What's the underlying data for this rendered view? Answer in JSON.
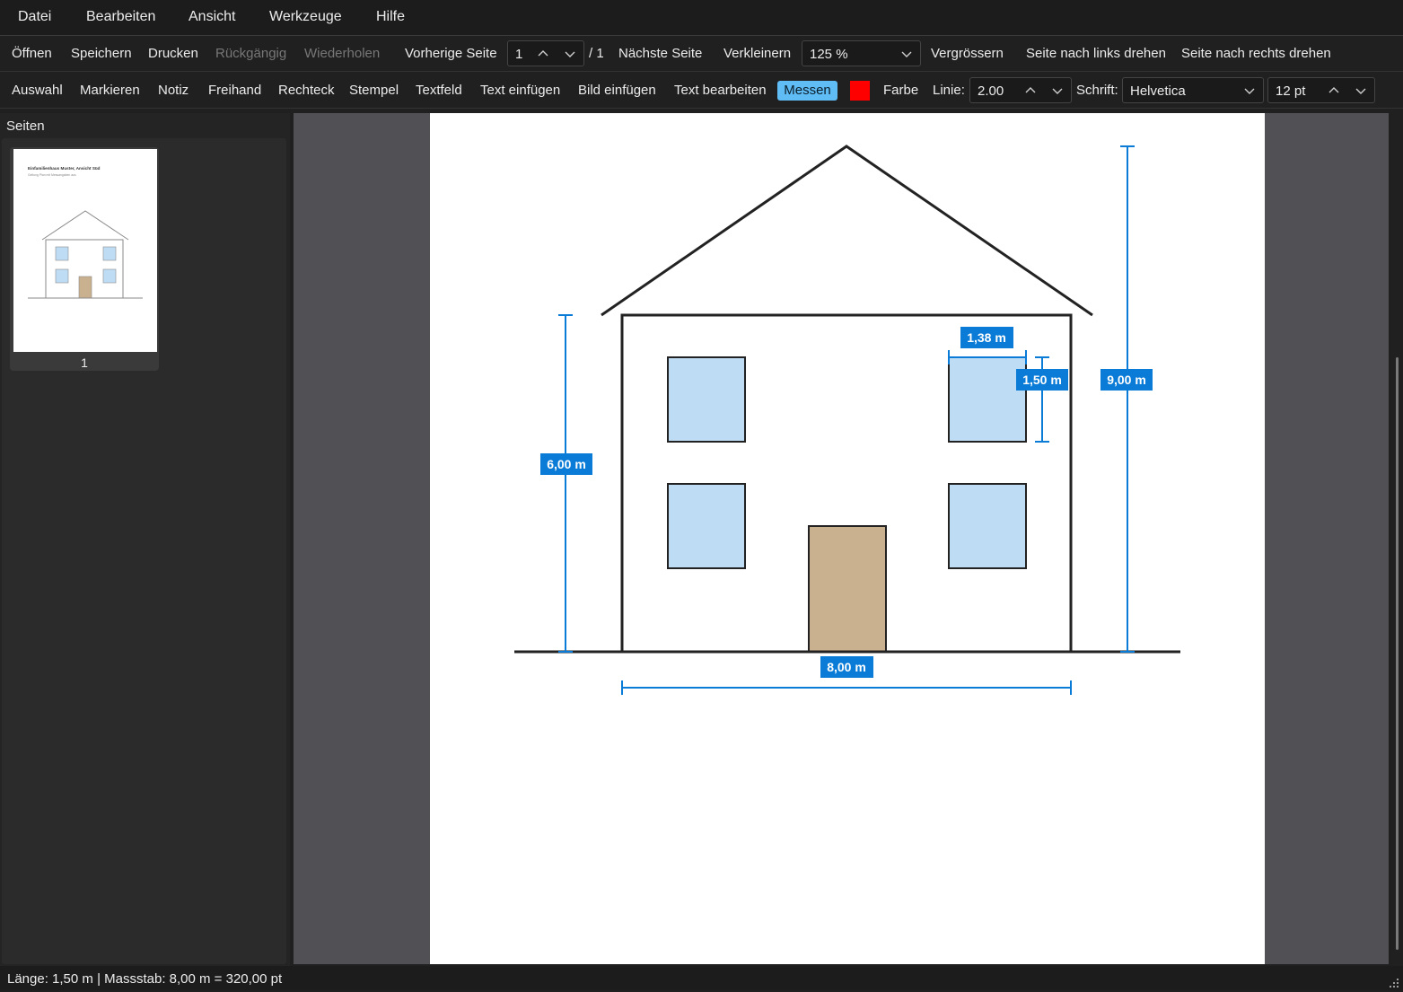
{
  "menu": [
    "Datei",
    "Bearbeiten",
    "Ansicht",
    "Werkzeuge",
    "Hilfe"
  ],
  "toolbar1": {
    "open": "Öffnen",
    "save": "Speichern",
    "print": "Drucken",
    "undo": "Rückgängig",
    "redo": "Wiederholen",
    "prev_page": "Vorherige Seite",
    "page_value": "1",
    "page_total": "/ 1",
    "next_page": "Nächste Seite",
    "zoom_out": "Verkleinern",
    "zoom_value": "125 %",
    "zoom_in": "Vergrössern",
    "rotate_left": "Seite nach links drehen",
    "rotate_right": "Seite nach rechts drehen"
  },
  "toolbar2": {
    "tools": [
      "Auswahl",
      "Markieren",
      "Notiz",
      "Freihand",
      "Rechteck",
      "Stempel",
      "Textfeld",
      "Text einfügen",
      "Bild einfügen",
      "Text bearbeiten"
    ],
    "active_tool": "Messen",
    "color_label": "Farbe",
    "color_value": "#ff0000",
    "line_label": "Linie:",
    "line_value": "2.00",
    "font_label": "Schrift:",
    "font_value": "Helvetica",
    "size_value": "12 pt"
  },
  "sidebar": {
    "title": "Seiten",
    "pages": [
      {
        "number": "1"
      }
    ],
    "thumb_title": "Einfamilienhaus Muster, Ansicht Süd",
    "thumb_subtitle": "Geltung Plan mit Messangaben aus"
  },
  "measurements": {
    "height_wall": "6,00 m",
    "height_total": "9,00 m",
    "width_window": "1,38 m",
    "height_window": "1,50 m",
    "width_house": "8,00 m"
  },
  "status": {
    "text": "Länge: 1,50 m  |  Massstab: 8,00 m = 320,00 pt"
  },
  "colors": {
    "accent": "#0a7bd6",
    "active_tool_bg": "#5fbcf5",
    "window_fill": "#bfdcf5",
    "door_fill": "#c9b08e"
  }
}
